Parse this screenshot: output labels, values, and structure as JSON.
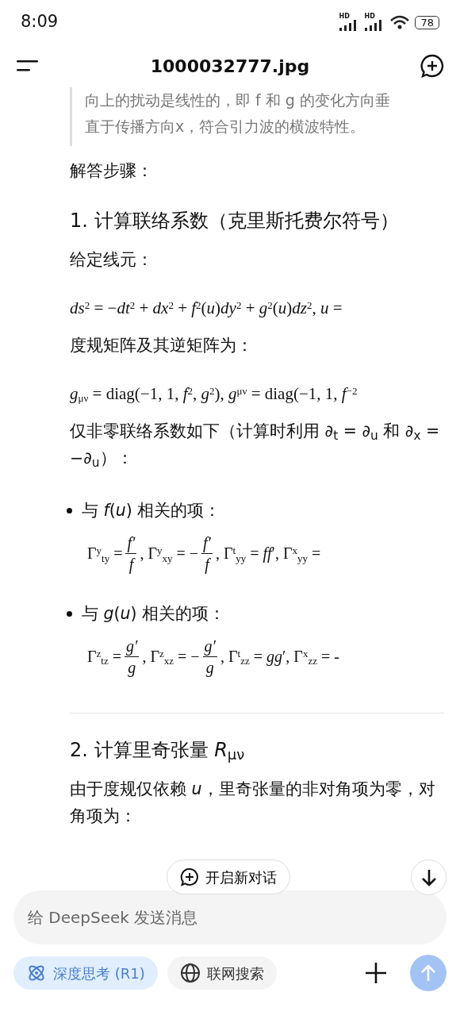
{
  "status_bar": {
    "time": "8:09",
    "signal_labels": [
      "HD",
      "HD"
    ],
    "battery": "78"
  },
  "header": {
    "title": "1000032777.jpg"
  },
  "quote": {
    "lines": [
      "向上的扰动是线性的，即 f 和 g 的变化方向垂",
      "直于传播方向x，符合引力波的横波特性。"
    ]
  },
  "blocks": [
    {
      "kind": "para",
      "text": "解答步骤："
    },
    {
      "kind": "heading",
      "text": "1. 计算联络系数（克里斯托费尔符号）"
    },
    {
      "kind": "para",
      "text": "给定线元："
    },
    {
      "kind": "formula",
      "text": "*ds*$^{2}$ = −*dt*$^{2}$ + *dx*$^{2}$ + *f*$^{2}$(*u*)*dy*$^{2}$ + *g*$^{2}$(*u*)*dz*$^{2}$,    *u* ="
    },
    {
      "kind": "para",
      "text": "度规矩阵及其逆矩阵为："
    },
    {
      "kind": "formula",
      "text": "*g*$_{μν}$ = diag(−1, 1, *f*$^{2}$, *g*$^{2}$),    *g*$^{μν}$ = diag(−1, 1, *f*$^{−2}$"
    },
    {
      "kind": "para",
      "text": "仅非零联络系数如下（计算时利用 *∂*$_{t}$ = *∂*$_{u}$ 和 *∂*$_{x}$ = −*∂*$_{u}$）："
    },
    {
      "kind": "bullet",
      "text": "与 *f*(*u*) 相关的项："
    },
    {
      "kind": "terms",
      "terms": [
        {
          "kind": "text",
          "text": "Γ$^{y}$$_{ty}$ ="
        },
        {
          "kind": "frac",
          "num": "f′",
          "den": "f"
        },
        {
          "kind": "text",
          "text": ",   Γ$^{y}$$_{xy}$ = −"
        },
        {
          "kind": "frac",
          "num": "f′",
          "den": "f"
        },
        {
          "kind": "text",
          "text": ",   Γ$^{t}$$_{yy}$ = *ff*′,   Γ$^{x}$$_{yy}$ ="
        }
      ]
    },
    {
      "kind": "bullet",
      "text": "与 *g*(*u*) 相关的项："
    },
    {
      "kind": "terms",
      "terms": [
        {
          "kind": "text",
          "text": "Γ$^{z}$$_{tz}$ ="
        },
        {
          "kind": "frac",
          "num": "g′",
          "den": "g"
        },
        {
          "kind": "text",
          "text": ",   Γ$^{z}$$_{xz}$ = −"
        },
        {
          "kind": "frac",
          "num": "g′",
          "den": "g"
        },
        {
          "kind": "text",
          "text": ",   Γ$^{t}$$_{zz}$ = *gg*′,   Γ$^{x}$$_{zz}$ = -"
        }
      ]
    },
    {
      "kind": "divider"
    },
    {
      "kind": "heading",
      "text": "2. 计算里奇张量 *R*$_{μν}$"
    },
    {
      "kind": "para",
      "text": "由于度规仅依赖 *u*，里奇张量的非对角项为零，对角项为："
    }
  ],
  "floating": {
    "new_chat": "开启新对话"
  },
  "composer": {
    "placeholder": "给 DeepSeek 发送消息",
    "chips": [
      {
        "kind": "think",
        "label": "深度思考 (R1)",
        "selected": true
      },
      {
        "kind": "search",
        "label": "联网搜索",
        "selected": false
      }
    ],
    "send_disabled": true
  }
}
